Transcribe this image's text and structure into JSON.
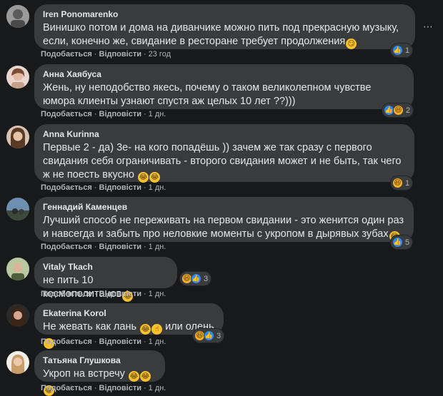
{
  "actions": {
    "like": "Подобається",
    "reply": "Відповісти",
    "dot": "·"
  },
  "more_icon": "⋯",
  "comments": [
    {
      "author": "Iren Ponomarenko",
      "text": "Винишко потом и дома на диванчике можно пить под прекрасную музыку, если, конечно же, свидание в ресторане требует продолжения",
      "time": "23 год",
      "reactions": {
        "icons": [
          "like"
        ],
        "count": "1"
      },
      "emojis": [
        "😏"
      ]
    },
    {
      "author": "Анна Хаябуса",
      "text": "Жень, ну неподобство якесь, почему о таком великолепном чувстве юмора клиенты узнают спустя аж целых 10 лет ??)))",
      "time": "1 дн.",
      "reactions": {
        "icons": [
          "like",
          "haha"
        ],
        "count": "2"
      },
      "emojis": []
    },
    {
      "author": "Anna Kurinna",
      "text": "Первые 2 - да) 3е- на кого попадёшь )) зачем же так сразу с первого свидания себя ограничивать - второго свидания может и не быть, так чего ж не поесть вкусно",
      "time": "1 дн.",
      "reactions": {
        "icons": [
          "haha"
        ],
        "count": "1"
      },
      "emojis": [
        "😂",
        "😂"
      ]
    },
    {
      "author": "Геннадий Каменцев",
      "text": "Лучший способ не переживать на первом свидании - это женится один раз и навсегда и забыть про неловкие моменты с укропом в дырявых зубах",
      "time": "1 дн.",
      "reactions": {
        "icons": [
          "like"
        ],
        "count": "5"
      },
      "emojis": [
        "😂"
      ]
    },
    {
      "author": "Vitaly Tkach",
      "text": "не пить 10 космополитанов",
      "time": "1 дн.",
      "reactions": {
        "icons": [
          "haha",
          "like"
        ],
        "count": "3"
      },
      "emojis": [
        "😂"
      ]
    },
    {
      "author": "Ekaterina Korol",
      "text": "Не жевать как лань",
      "text2": "или олень",
      "time": "1 дн.",
      "reactions": {
        "icons": [
          "haha",
          "like"
        ],
        "count": "3"
      },
      "emojis": [
        "😂",
        "☝"
      ],
      "emojis2": [
        "👌"
      ]
    },
    {
      "author": "Татьяна Глушкова",
      "text": "Укроп на встречу",
      "time": "1 дн.",
      "reactions": {
        "icons": [],
        "count": ""
      },
      "emojis": [
        "😂",
        "😂",
        "😂"
      ]
    }
  ],
  "colors": {
    "background": "#18191a",
    "bubble": "#3a3b3c",
    "like": "#2d88ff",
    "haha": "#f7b125"
  }
}
